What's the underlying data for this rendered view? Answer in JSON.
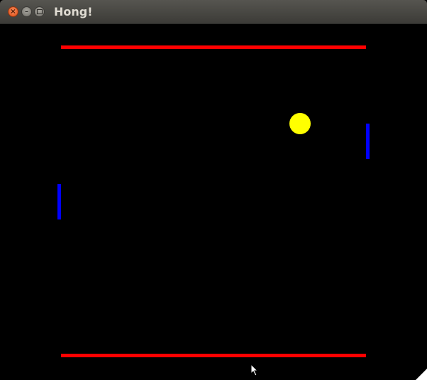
{
  "window": {
    "title": "Hong!",
    "controls": {
      "close_icon": "close-icon",
      "minimize_icon": "minimize-icon",
      "maximize_icon": "maximize-icon"
    }
  },
  "game": {
    "colors": {
      "background": "#000000",
      "walls": "#ff0000",
      "paddles": "#0000ff",
      "ball": "#ffff00"
    }
  }
}
